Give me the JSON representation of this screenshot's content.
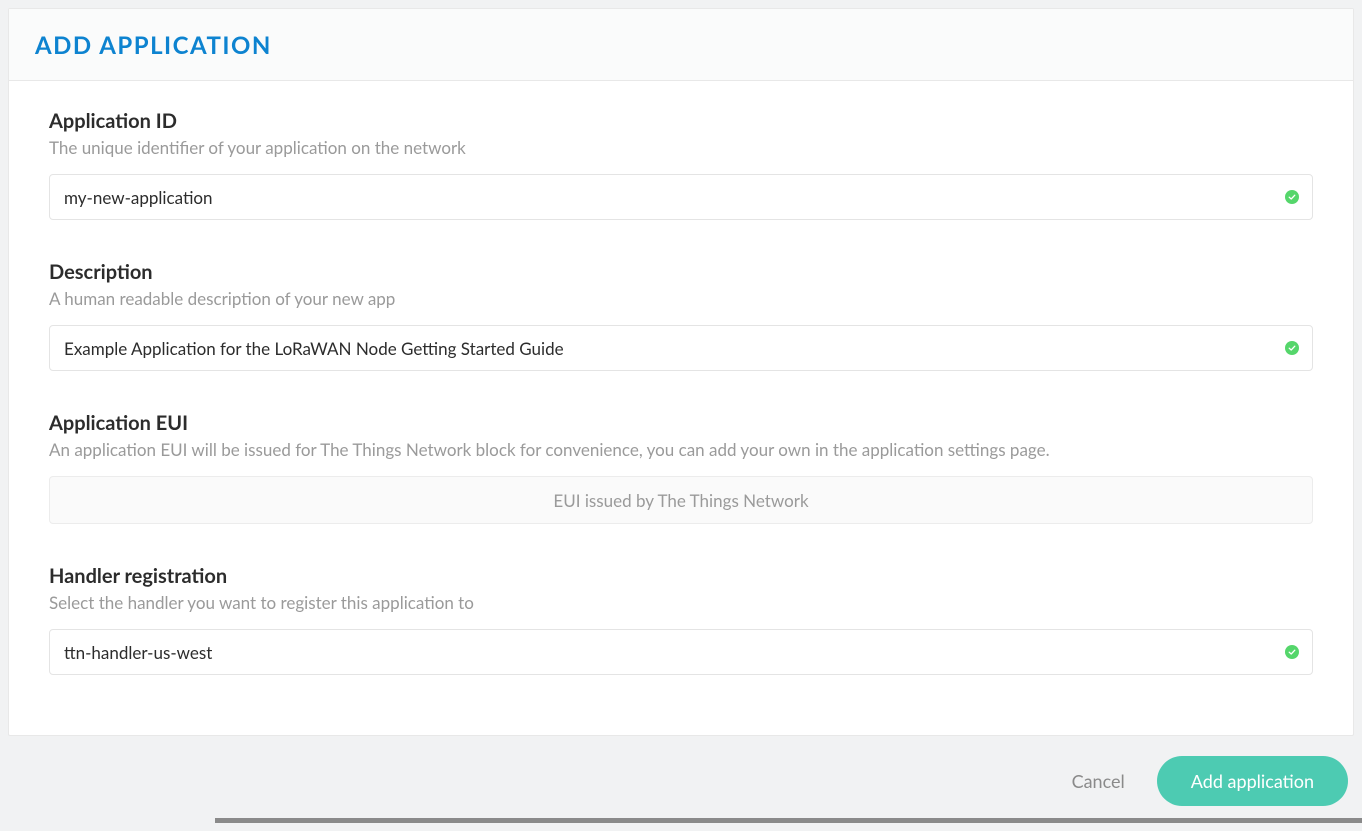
{
  "panel": {
    "title": "ADD APPLICATION"
  },
  "fields": {
    "app_id": {
      "label": "Application ID",
      "help": "The unique identifier of your application on the network",
      "value": "my-new-application"
    },
    "description": {
      "label": "Description",
      "help": "A human readable description of your new app",
      "value": "Example Application for the LoRaWAN Node Getting Started Guide"
    },
    "app_eui": {
      "label": "Application EUI",
      "help": "An application EUI will be issued for The Things Network block for convenience, you can add your own in the application settings page.",
      "static_text": "EUI issued by The Things Network"
    },
    "handler": {
      "label": "Handler registration",
      "help": "Select the handler you want to register this application to",
      "value": "ttn-handler-us-west"
    }
  },
  "actions": {
    "cancel": "Cancel",
    "submit": "Add application"
  },
  "colors": {
    "accent": "#0d83d0",
    "primary_button": "#4dcbb2",
    "valid": "#55d66b"
  }
}
